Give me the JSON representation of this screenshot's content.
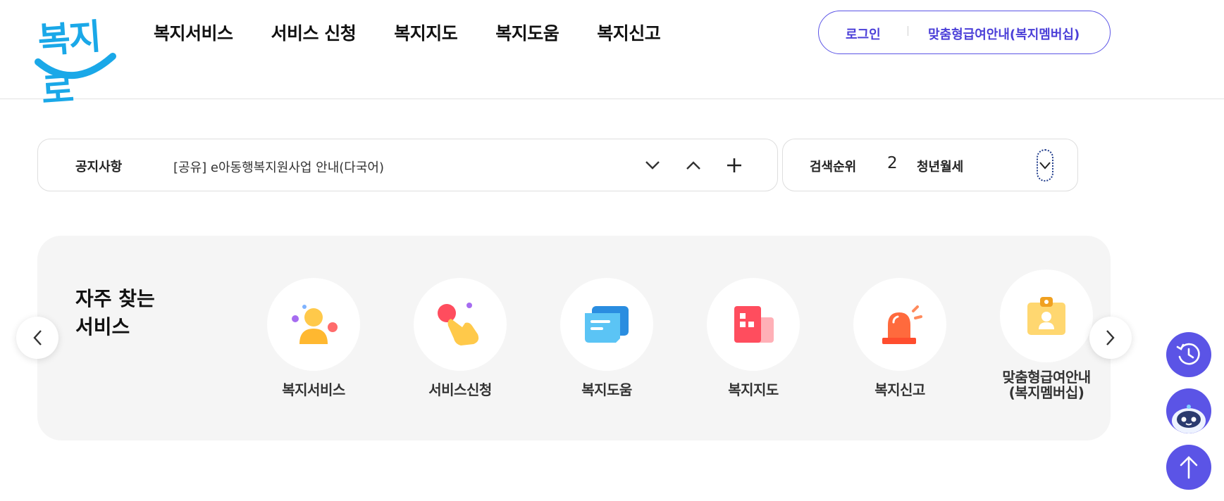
{
  "header": {
    "logo_text": "복지로",
    "nav": [
      "복지서비스",
      "서비스 신청",
      "복지지도",
      "복지도움",
      "복지신고"
    ],
    "login_label": "로그인",
    "member_label": "맞춤형급여안내(복지멤버십)"
  },
  "notice": {
    "label": "공지사항",
    "text": "[공유] e아동행복지원사업 안내(다국어)"
  },
  "ranking": {
    "label": "검색순위",
    "rank": "2",
    "keyword": "청년월세"
  },
  "quick": {
    "title_line1": "자주 찾는",
    "title_line2": "서비스",
    "items": [
      {
        "label": "복지서비스",
        "icon": "person-icon"
      },
      {
        "label": "서비스신청",
        "icon": "hand-tap-icon"
      },
      {
        "label": "복지도움",
        "icon": "chat-bubble-icon"
      },
      {
        "label": "복지지도",
        "icon": "building-icon"
      },
      {
        "label": "복지신고",
        "icon": "siren-icon"
      },
      {
        "label_line1": "맞춤형급여안내",
        "label_line2": "(복지멤버십)",
        "icon": "id-card-icon"
      }
    ]
  },
  "colors": {
    "brand": "#1aa8e8",
    "accent": "#5b54e6",
    "float_bg": "#5b54e6"
  },
  "floating": [
    "history-icon",
    "chatbot-icon",
    "scroll-top-icon"
  ]
}
